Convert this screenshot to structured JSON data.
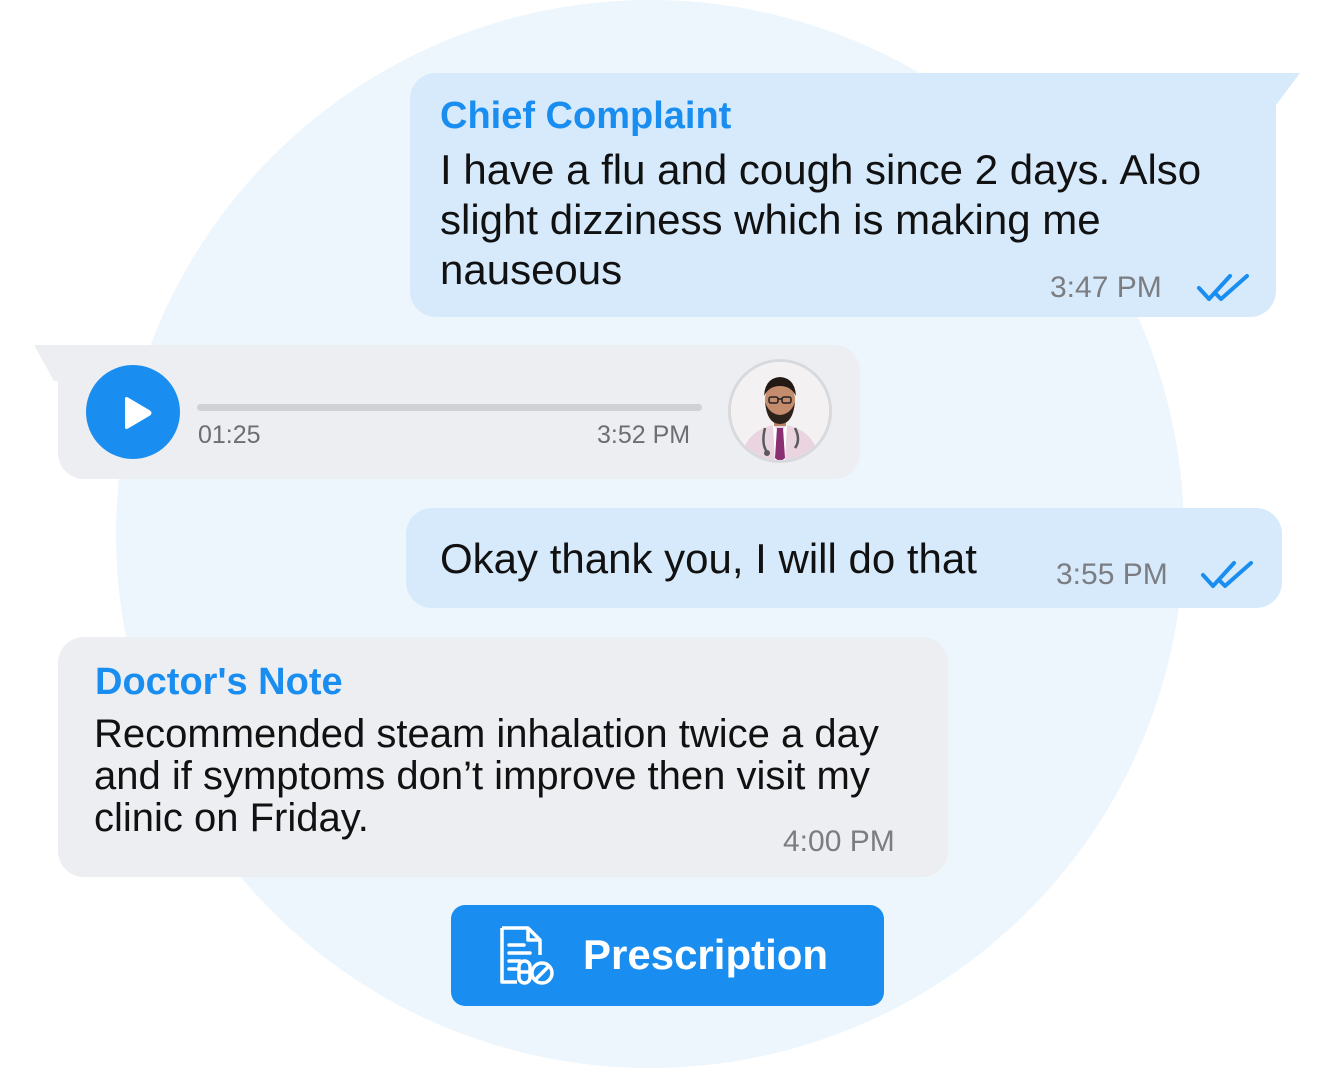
{
  "colors": {
    "accent": "#1a8ef0",
    "outgoing_bubble": "#d6eafb",
    "incoming_bubble": "#edeef2",
    "background_circle": "#ecf6fc"
  },
  "messages": [
    {
      "title": "Chief Complaint",
      "text": "I have a flu and cough since 2 days. Also slight dizziness which is making me nauseous",
      "time": "3:47 PM",
      "status_icon": "double-check-icon"
    },
    {
      "type": "voice",
      "duration": "01:25",
      "time": "3:52 PM",
      "play_icon": "play-icon",
      "avatar_icon": "doctor-avatar"
    },
    {
      "text": "Okay thank you, I will do that",
      "time": "3:55 PM",
      "status_icon": "double-check-icon"
    },
    {
      "title": "Doctor's Note",
      "text": "Recommended steam inhalation twice a day and if symptoms don’t improve then visit my clinic on Friday.",
      "time": "4:00 PM"
    }
  ],
  "prescription_button": {
    "label": "Prescription",
    "icon": "prescription-icon"
  }
}
